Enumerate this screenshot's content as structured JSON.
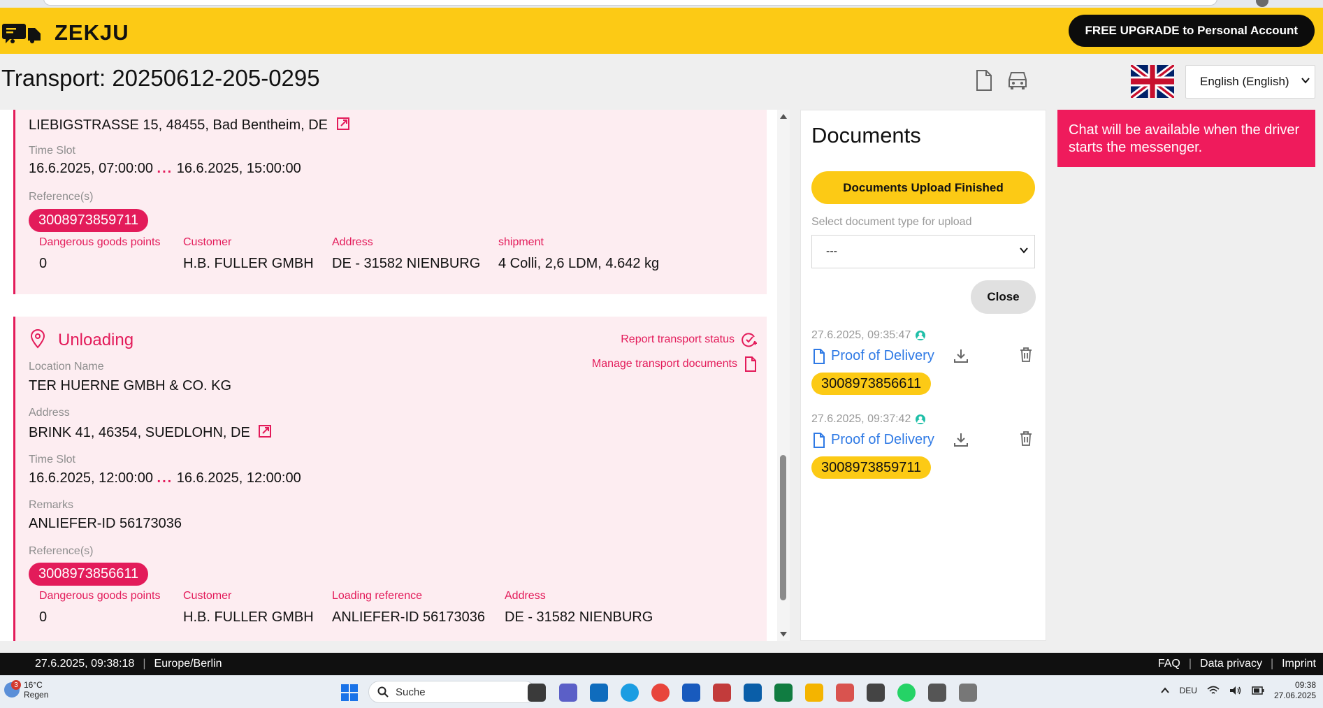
{
  "header": {
    "logo_text": "ZEKJU",
    "upgrade_label": "FREE UPGRADE to Personal Account"
  },
  "page": {
    "title": "Transport: 20250612-205-0295",
    "language": "English (English)"
  },
  "loading": {
    "address": "LIEBIGSTRASSE 15, 48455, Bad Bentheim, DE",
    "time_slot_label": "Time Slot",
    "time_start": "16.6.2025, 07:00:00",
    "time_sep": "...",
    "time_end": "16.6.2025, 15:00:00",
    "references_label": "Reference(s)",
    "reference": "3008973859711",
    "details": [
      {
        "label": "Dangerous goods points",
        "value": "0"
      },
      {
        "label": "Customer",
        "value": "H.B. FULLER GMBH"
      },
      {
        "label": "Address",
        "value": "DE - 31582 NIENBURG"
      },
      {
        "label": "shipment",
        "value": "4 Colli, 2,6 LDM, 4.642 kg"
      }
    ]
  },
  "unloading": {
    "title": "Unloading",
    "report_status_label": "Report transport status",
    "manage_docs_label": "Manage transport documents",
    "location_name_label": "Location Name",
    "location_name": "TER HUERNE GMBH & CO. KG",
    "address_label": "Address",
    "address": "BRINK 41, 46354, SUEDLOHN, DE",
    "time_slot_label": "Time Slot",
    "time_start": "16.6.2025, 12:00:00",
    "time_sep": "...",
    "time_end": "16.6.2025, 12:00:00",
    "remarks_label": "Remarks",
    "remarks": "ANLIEFER-ID 56173036",
    "references_label": "Reference(s)",
    "reference": "3008973856611",
    "details": [
      {
        "label": "Dangerous goods points",
        "value": "0"
      },
      {
        "label": "Customer",
        "value": "H.B. FULLER GMBH"
      },
      {
        "label": "Loading reference",
        "value": "ANLIEFER-ID 56173036"
      },
      {
        "label": "Address",
        "value": "DE - 31582 NIENBURG"
      }
    ]
  },
  "documents": {
    "title": "Documents",
    "upload_finished_label": "Documents Upload Finished",
    "doc_type_label": "Select document type for upload",
    "doc_type_value": "---",
    "close_label": "Close",
    "entries": [
      {
        "timestamp": "27.6.2025, 09:35:47",
        "name": "Proof of Delivery",
        "reference": "3008973856611"
      },
      {
        "timestamp": "27.6.2025, 09:37:42",
        "name": "Proof of Delivery",
        "reference": "3008973859711"
      }
    ]
  },
  "chat": {
    "notice": "Chat will be available when the driver starts the messenger."
  },
  "footer": {
    "datetime": "27.6.2025, 09:38:18",
    "sep": "|",
    "timezone": "Europe/Berlin",
    "faq": "FAQ",
    "privacy": "Data privacy",
    "imprint": "Imprint"
  },
  "taskbar": {
    "weather_temp": "16°C",
    "weather_desc": "Regen",
    "weather_badge": "3",
    "search_placeholder": "Suche",
    "keyboard_lang": "DEU",
    "time": "09:38",
    "date": "27.06.2025"
  },
  "colors": {
    "brand_yellow": "#fcca15",
    "accent_pink": "#e31b5a",
    "card_bg": "#fdedf1",
    "link_blue": "#2f7ae5"
  }
}
